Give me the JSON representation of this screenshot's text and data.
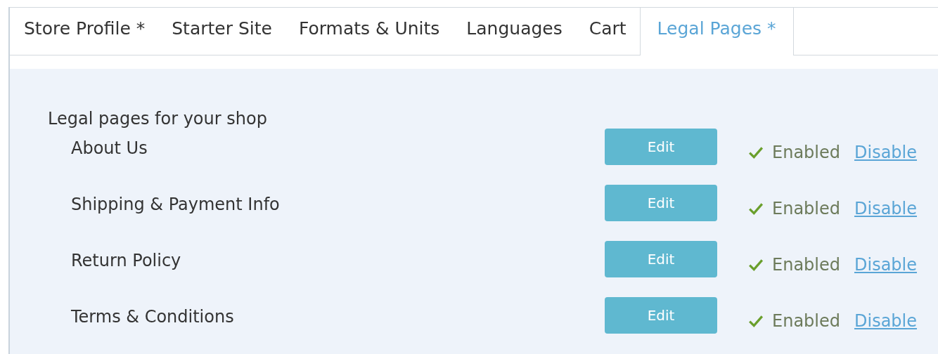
{
  "tabs": [
    {
      "label": "Store Profile *",
      "selected": false
    },
    {
      "label": "Starter Site",
      "selected": false
    },
    {
      "label": "Formats & Units",
      "selected": false
    },
    {
      "label": "Languages",
      "selected": false
    },
    {
      "label": "Cart",
      "selected": false
    },
    {
      "label": "Legal Pages *",
      "selected": true
    }
  ],
  "heading": "Legal pages for your shop",
  "pages": [
    {
      "name": "About Us",
      "button": "Edit",
      "enabled": true,
      "status": "Enabled",
      "action": "Disable"
    },
    {
      "name": "Shipping & Payment Info",
      "button": "Edit",
      "enabled": true,
      "status": "Enabled",
      "action": "Disable"
    },
    {
      "name": "Return Policy",
      "button": "Edit",
      "enabled": true,
      "status": "Enabled",
      "action": "Disable"
    },
    {
      "name": "Terms & Conditions",
      "button": "Edit",
      "enabled": true,
      "status": "Enabled",
      "action": "Disable"
    }
  ]
}
